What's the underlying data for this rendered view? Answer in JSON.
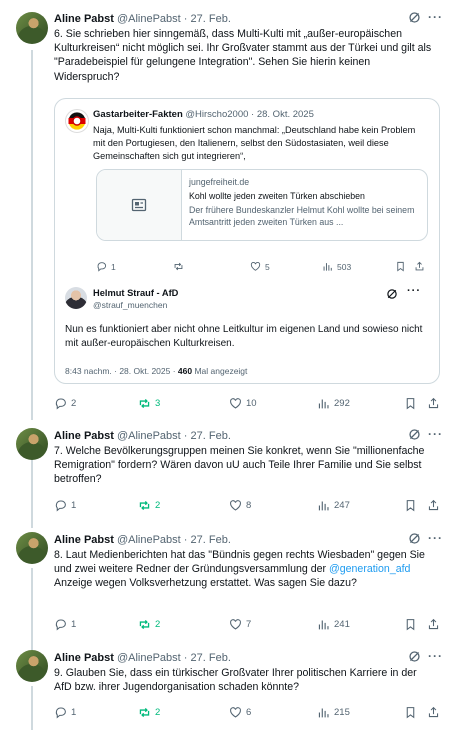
{
  "posts": [
    {
      "name": "Aline Pabst",
      "handle": "@AlinePabst",
      "date": "· 27. Feb.",
      "text": "6. Sie schrieben hier sinngemäß, dass Multi-Kulti mit „außer-europäischen Kulturkreisen“ nicht möglich sei. Ihr Großvater stammt aus der Türkei und gilt als \"Paradebeispiel für gelungene Integration\". Sehen Sie hierin keinen Widerspruch?",
      "replies": "2",
      "reposts": "3",
      "likes": "10",
      "views": "292"
    },
    {
      "name": "Aline Pabst",
      "handle": "@AlinePabst",
      "date": "· 27. Feb.",
      "text": "7. Welche Bevölkerungsgruppen meinen Sie konkret, wenn Sie \"millionenfache Remigration\" fordern? Wären davon uU auch Teile Ihrer Familie und Sie selbst betroffen?",
      "replies": "1",
      "reposts": "2",
      "likes": "8",
      "views": "247"
    },
    {
      "name": "Aline Pabst",
      "handle": "@AlinePabst",
      "date": "· 27. Feb.",
      "text_before": "8. Laut Medienberichten hat das \"Bündnis gegen rechts Wiesbaden\" gegen Sie und zwei weitere Redner der Gründungsversammlung der ",
      "mention": "@generation_afd",
      "text_after": " Anzeige wegen Volksverhetzung erstattet. Was sagen Sie dazu?",
      "replies": "1",
      "reposts": "2",
      "likes": "7",
      "views": "241"
    },
    {
      "name": "Aline Pabst",
      "handle": "@AlinePabst",
      "date": "· 27. Feb.",
      "text": "9. Glauben Sie, dass ein türkischer Großvater Ihrer politischen Karriere in der AfD bzw. ihrer Jugendorganisation schaden könnte?",
      "replies": "1",
      "reposts": "2",
      "likes": "6",
      "views": "215"
    }
  ],
  "quote": {
    "name": "Gastarbeiter-Fakten",
    "handle": "@Hirscho2000",
    "date": "· 28. Okt. 2025",
    "text": "Naja, Multi-Kulti funktioniert schon manchmal: „Deutschland habe kein Problem mit den Portugiesen, den Italienern, selbst den Südostasiaten, weil diese Gemeinschaften sich gut integrieren“,",
    "card": {
      "domain": "jungefreiheit.de",
      "title": "Kohl wollte jeden zweiten Türken abschieben",
      "desc": "Der frühere Bundeskanzler Helmut Kohl wollte bei seinem Amtsantritt jeden zweiten Türken aus ..."
    },
    "replies": "1",
    "likes": "5",
    "views": "503",
    "reply": {
      "name": "Helmut Strauf - AfD",
      "handle": "@strauf_muenchen",
      "text": "Nun es funktioniert aber nicht ohne Leitkultur im eigenen Land und sowieso nicht mit außer-europäischen Kulturkreisen.",
      "time": "8:43 nachm. · 28. Okt. 2025 · ",
      "views_count": "460",
      "views_label": " Mal angezeigt"
    }
  },
  "colors": {
    "accent": "#1d9bf0",
    "repost_active": "#00ba7c",
    "muted": "#536471"
  }
}
